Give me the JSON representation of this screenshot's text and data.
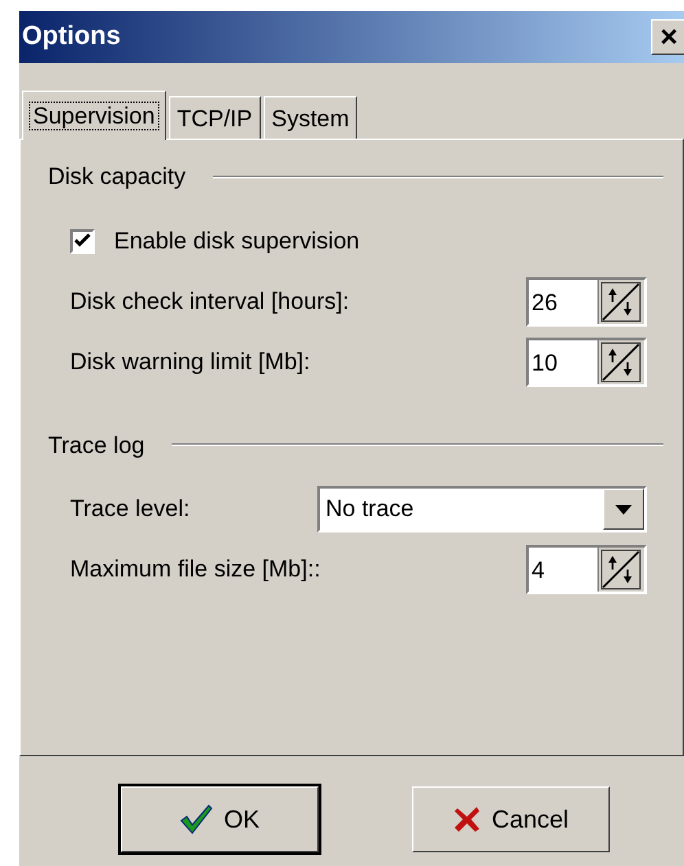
{
  "window": {
    "title": "Options",
    "close": "×"
  },
  "tabs": [
    {
      "label": "Supervision",
      "selected": true
    },
    {
      "label": "TCP/IP",
      "selected": false
    },
    {
      "label": "System",
      "selected": false
    }
  ],
  "groups": [
    {
      "title": "Disk capacity",
      "rows": [
        {
          "kind": "checkbox",
          "label": "Enable disk supervision",
          "checked": true
        },
        {
          "kind": "spin",
          "label": "Disk check interval [hours]:",
          "value": "26"
        },
        {
          "kind": "spin",
          "label": "Disk warning limit [Mb]:",
          "value": "10"
        }
      ]
    },
    {
      "title": "Trace log",
      "rows": [
        {
          "kind": "dropdown",
          "label": "Trace level:",
          "value": "No trace"
        },
        {
          "kind": "spin",
          "label": "Maximum file size [Mb]::",
          "value": "4"
        }
      ]
    }
  ],
  "buttons": [
    {
      "kind": "ok",
      "label": "OK",
      "default": true
    },
    {
      "kind": "cancel",
      "label": "Cancel",
      "default": false
    }
  ]
}
